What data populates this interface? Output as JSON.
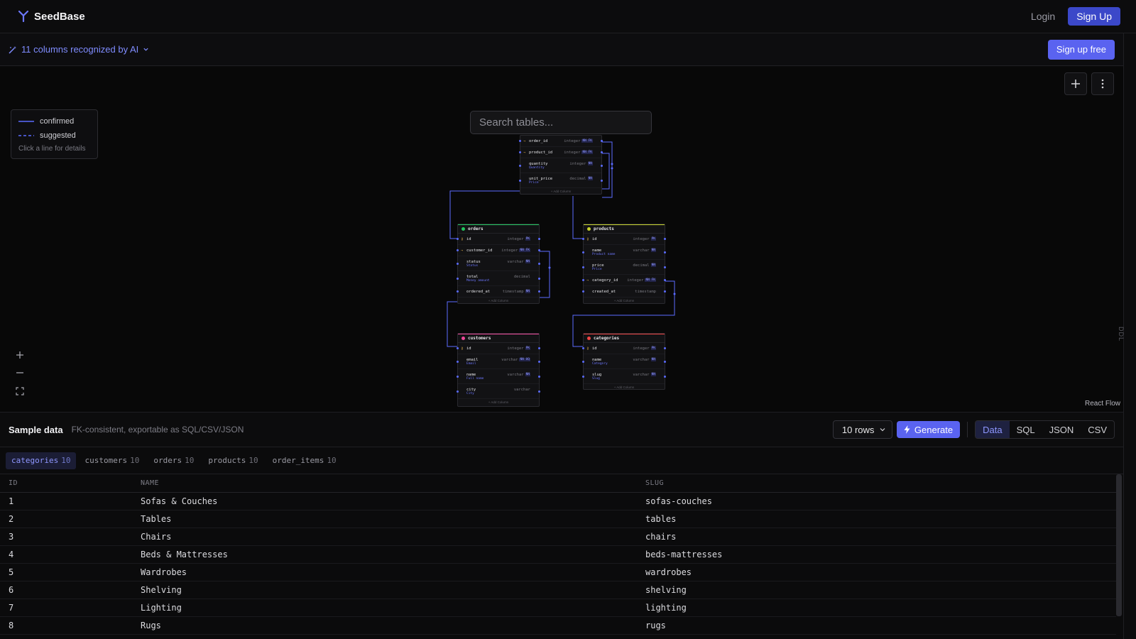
{
  "app": {
    "name": "SeedBase"
  },
  "nav": {
    "login": "Login",
    "signup": "Sign Up"
  },
  "ai_bar": {
    "detected": "11 columns recognized by AI",
    "cta": "Sign up free"
  },
  "canvas": {
    "search_placeholder": "Search tables...",
    "legend": {
      "confirmed": "confirmed",
      "suggested": "suggested",
      "hint": "Click a line for details"
    },
    "attribution": "React Flow",
    "side_label": "DDL"
  },
  "schema": {
    "order_items": {
      "columns": [
        {
          "name": "order_id",
          "type": "integer",
          "badges": "NN FK",
          "sub": ""
        },
        {
          "name": "product_id",
          "type": "integer",
          "badges": "NN FK",
          "sub": ""
        },
        {
          "name": "quantity",
          "type": "integer",
          "badges": "NN",
          "sub": "Quantity"
        },
        {
          "name": "unit_price",
          "type": "decimal",
          "badges": "NN",
          "sub": "Price"
        }
      ],
      "add": "+ Add Column"
    },
    "orders": {
      "title": "orders",
      "columns": [
        {
          "name": "id",
          "type": "integer",
          "badges": "PK",
          "sub": ""
        },
        {
          "name": "customer_id",
          "type": "integer",
          "badges": "NN FK",
          "sub": ""
        },
        {
          "name": "status",
          "type": "varchar",
          "badges": "NN",
          "sub": "Status"
        },
        {
          "name": "total",
          "type": "decimal",
          "badges": "",
          "sub": "Money amount"
        },
        {
          "name": "ordered_at",
          "type": "timestamp",
          "badges": "NN",
          "sub": ""
        }
      ],
      "add": "+ Add Column"
    },
    "products": {
      "title": "products",
      "columns": [
        {
          "name": "id",
          "type": "integer",
          "badges": "PK",
          "sub": ""
        },
        {
          "name": "name",
          "type": "varchar",
          "badges": "NN",
          "sub": "Product name"
        },
        {
          "name": "price",
          "type": "decimal",
          "badges": "NN",
          "sub": "Price"
        },
        {
          "name": "category_id",
          "type": "integer",
          "badges": "NN FK",
          "sub": ""
        },
        {
          "name": "created_at",
          "type": "timestamp",
          "badges": "",
          "sub": ""
        }
      ],
      "add": "+ Add Column"
    },
    "customers": {
      "title": "customers",
      "columns": [
        {
          "name": "id",
          "type": "integer",
          "badges": "PK",
          "sub": ""
        },
        {
          "name": "email",
          "type": "varchar",
          "badges": "NN UQ",
          "sub": "Email"
        },
        {
          "name": "name",
          "type": "varchar",
          "badges": "NN",
          "sub": "Full name"
        },
        {
          "name": "city",
          "type": "varchar",
          "badges": "",
          "sub": "City"
        }
      ],
      "add": "+ Add Column"
    },
    "categories": {
      "title": "categories",
      "columns": [
        {
          "name": "id",
          "type": "integer",
          "badges": "PK",
          "sub": ""
        },
        {
          "name": "name",
          "type": "varchar",
          "badges": "NN",
          "sub": "Category"
        },
        {
          "name": "slug",
          "type": "varchar",
          "badges": "NN",
          "sub": "Slug"
        }
      ],
      "add": "+ Add Column"
    }
  },
  "sample": {
    "title": "Sample data",
    "subtitle": "FK-consistent, exportable as SQL/CSV/JSON",
    "rows_option": "10 rows",
    "generate": "Generate",
    "formats": [
      "Data",
      "SQL",
      "JSON",
      "CSV"
    ],
    "active_format": "Data",
    "tabs": [
      {
        "name": "categories",
        "count": "10"
      },
      {
        "name": "customers",
        "count": "10"
      },
      {
        "name": "orders",
        "count": "10"
      },
      {
        "name": "products",
        "count": "10"
      },
      {
        "name": "order_items",
        "count": "10"
      }
    ],
    "active_tab": "categories",
    "columns": [
      "ID",
      "NAME",
      "SLUG"
    ],
    "rows": [
      [
        "1",
        "Sofas & Couches",
        "sofas-couches"
      ],
      [
        "2",
        "Tables",
        "tables"
      ],
      [
        "3",
        "Chairs",
        "chairs"
      ],
      [
        "4",
        "Beds & Mattresses",
        "beds-mattresses"
      ],
      [
        "5",
        "Wardrobes",
        "wardrobes"
      ],
      [
        "6",
        "Shelving",
        "shelving"
      ],
      [
        "7",
        "Lighting",
        "lighting"
      ],
      [
        "8",
        "Rugs",
        "rugs"
      ]
    ]
  },
  "colors": {
    "accent": "#5a63f0",
    "edge": "#5b6bff",
    "orders": "#22c55e",
    "products": "#c6d22b",
    "customers": "#ec4899",
    "categories": "#ef4444"
  }
}
